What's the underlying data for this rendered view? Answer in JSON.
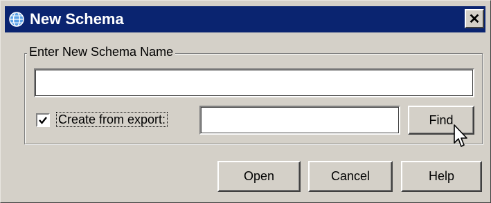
{
  "window": {
    "title": "New Schema",
    "close_glyph": "✕",
    "title_bar_color": "#0a2470",
    "app_icon": "globe-icon"
  },
  "group": {
    "label": "Enter New Schema Name"
  },
  "schema_name_field": {
    "value": ""
  },
  "create_from_export": {
    "checked": true,
    "label": "Create from export:"
  },
  "export_field": {
    "value": ""
  },
  "buttons": {
    "find": "Find",
    "open": "Open",
    "cancel": "Cancel",
    "help": "Help"
  }
}
